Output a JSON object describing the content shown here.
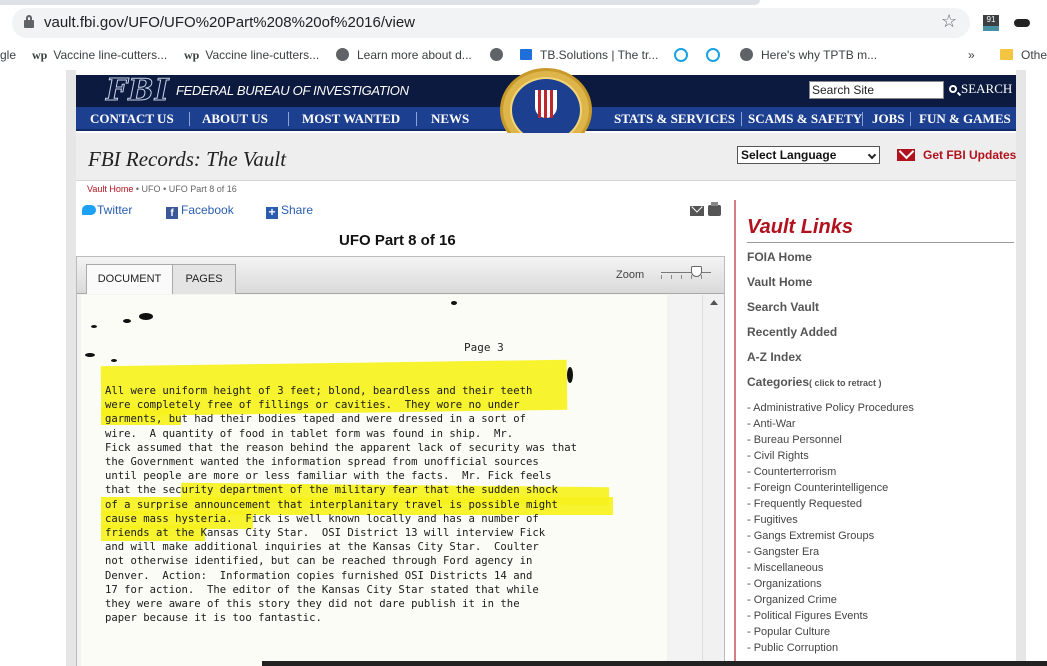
{
  "browser": {
    "url": "vault.fbi.gov/UFO/UFO%20Part%208%20of%2016/view",
    "ext_badge": "91",
    "bookmarks": [
      {
        "label": "gle",
        "icon": ""
      },
      {
        "label": "Vaccine line-cutters...",
        "icon": "wp"
      },
      {
        "label": "Vaccine line-cutters...",
        "icon": "wp"
      },
      {
        "label": "Learn more about d...",
        "icon": "wordpress-icon"
      },
      {
        "label": "",
        "icon": "globe-icon"
      },
      {
        "label": "TB.Solutions | The tr...",
        "icon": "tb-icon"
      },
      {
        "label": "Here's why TPTB m...",
        "icon": "globe-icon"
      },
      {
        "label": "»",
        "icon": ""
      },
      {
        "label": "Othe",
        "icon": "folder-icon"
      }
    ]
  },
  "header": {
    "logo": "FBI",
    "agency": "FEDERAL BUREAU OF INVESTIGATION",
    "search_placeholder": "Search Site",
    "search_label": "SEARCH",
    "nav": [
      "CONTACT US",
      "ABOUT US",
      "MOST WANTED",
      "NEWS",
      "STATS & SERVICES",
      "SCAMS & SAFETY",
      "JOBS",
      "FUN & GAMES"
    ]
  },
  "records": {
    "title": "FBI Records: The Vault",
    "language": "Select Language",
    "updates": "Get FBI Updates"
  },
  "breadcrumb": {
    "home": "Vault Home",
    "sep": "•",
    "section": "UFO",
    "current": "UFO Part 8 of 16"
  },
  "social": {
    "twitter": "Twitter",
    "facebook": "Facebook",
    "share": "Share"
  },
  "document": {
    "title": "UFO Part 8 of 16",
    "tabs": [
      "DOCUMENT",
      "PAGES"
    ],
    "zoom_label": "Zoom",
    "page_label": "Page 3",
    "lines": [
      "All were uniform height of 3 feet; blond, beardless and their teeth",
      "were completely free of fillings or cavities.  They wore no under",
      "garments, but had their bodies taped and were dressed in a sort of",
      "wire.  A quantity of food in tablet form was found in ship.  Mr.",
      "Fick assumed that the reason behind the apparent lack of security was that",
      "the Government wanted the information spread from unofficial sources",
      "until people are more or less familiar with the facts.  Mr. Fick feels",
      "that the security department of the military fear that the sudden shock",
      "of a surprise announcement that interplanitary travel is possible might",
      "cause mass hysteria.  Fick is well known locally and has a number of",
      "friends at the Kansas City Star.  OSI District 13 will interview Fick",
      "and will make additional inquiries at the Kansas City Star.  Coulter",
      "not otherwise identified, but can be reached through Ford agency in",
      "Denver.  Action:  Information copies furnished OSI Districts 14 and",
      "17 for action.  The editor of the Kansas City Star stated that while",
      "they were aware of this story they did not dare publish it in the",
      "paper because it is too fantastic."
    ]
  },
  "sidebar": {
    "title": "Vault Links",
    "links": [
      "FOIA Home",
      "Vault Home",
      "Search Vault",
      "Recently Added",
      "A-Z Index"
    ],
    "categories_label": "Categories",
    "categories_toggle": "( click to retract )",
    "categories": [
      "- Administrative Policy Procedures",
      "- Anti-War",
      "- Bureau Personnel",
      "- Civil Rights",
      "- Counterterrorism",
      "- Foreign Counterintelligence",
      "- Frequently Requested",
      "- Fugitives",
      "- Gangs Extremist Groups",
      "- Gangster Era",
      "- Miscellaneous",
      "- Organizations",
      "- Organized Crime",
      "- Political Figures Events",
      "- Popular Culture",
      "- Public Corruption"
    ]
  },
  "colors": {
    "navy": "#0b1a3e",
    "nav_blue": "#1c3f8f",
    "accent_red": "#b1121d",
    "highlight": "#f6f21c"
  }
}
